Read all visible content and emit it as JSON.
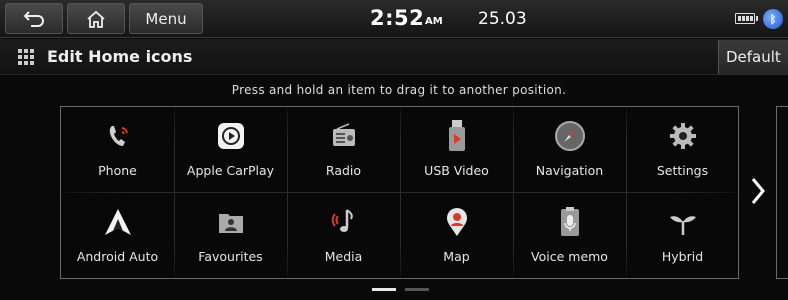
{
  "topbar": {
    "back_icon": "back-arrow-icon",
    "home_icon": "home-icon",
    "menu_label": "Menu",
    "time": "2:52",
    "ampm": "AM",
    "date": "25.03",
    "battery_icon": "battery-icon",
    "bluetooth_icon": "bluetooth-icon"
  },
  "header": {
    "title": "Edit Home icons",
    "default_label": "Default"
  },
  "hint": "Press and hold an item to drag it to another position.",
  "apps": [
    {
      "label": "Phone",
      "icon": "phone-icon"
    },
    {
      "label": "Apple CarPlay",
      "icon": "carplay-icon"
    },
    {
      "label": "Radio",
      "icon": "radio-icon"
    },
    {
      "label": "USB Video",
      "icon": "usb-video-icon"
    },
    {
      "label": "Navigation",
      "icon": "navigation-icon"
    },
    {
      "label": "Settings",
      "icon": "settings-icon"
    },
    {
      "label": "Android Auto",
      "icon": "android-auto-icon"
    },
    {
      "label": "Favourites",
      "icon": "favourites-icon"
    },
    {
      "label": "Media",
      "icon": "media-icon"
    },
    {
      "label": "Map",
      "icon": "map-icon"
    },
    {
      "label": "Voice memo",
      "icon": "voice-memo-icon"
    },
    {
      "label": "Hybrid",
      "icon": "hybrid-icon"
    }
  ],
  "pagination": {
    "pages": 2,
    "current": 1
  },
  "colors": {
    "accent_red": "#d93a2b",
    "text": "#e8e8e8",
    "panel_border": "#6a6a6a"
  }
}
